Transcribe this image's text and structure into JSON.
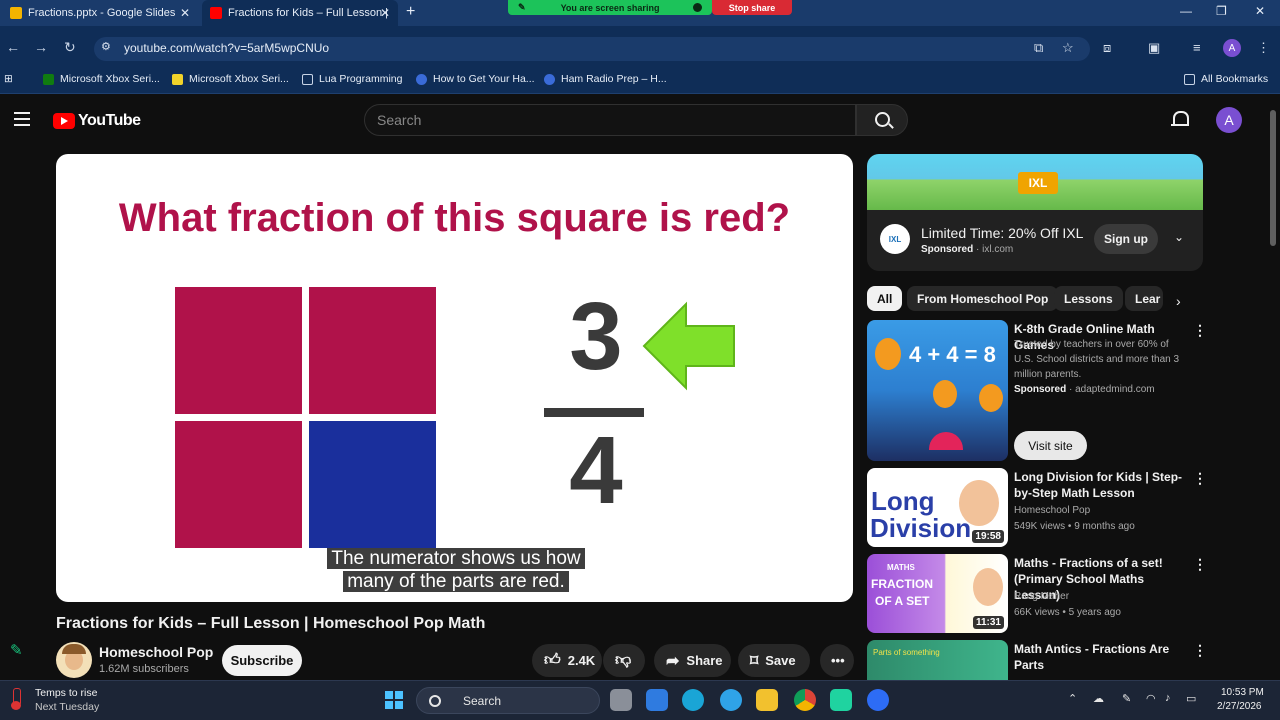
{
  "browser": {
    "tabs": [
      {
        "label": "Fractions.pptx - Google Slides"
      },
      {
        "label": "Fractions for Kids – Full Lesson |"
      }
    ],
    "screen_sharing": "You are screen sharing",
    "stop_share": "Stop share",
    "url": "youtube.com/watch?v=5arM5wpCNUo",
    "profile_initial": "A",
    "bookmarks": [
      {
        "label": "Microsoft Xbox Seri..."
      },
      {
        "label": "Microsoft Xbox Seri..."
      },
      {
        "label": "Lua Programming"
      },
      {
        "label": "How to Get Your Ha..."
      },
      {
        "label": "Ham Radio Prep – H..."
      }
    ],
    "all_bookmarks": "All Bookmarks"
  },
  "youtube": {
    "logo_text": "YouTube",
    "search_placeholder": "Search",
    "avatar_initial": "A"
  },
  "video": {
    "slide_question": "What fraction of this square is red?",
    "fraction_numerator": "3",
    "fraction_denominator": "4",
    "caption_line1": "The numerator shows us how",
    "caption_line2": "many of the parts are red.",
    "title": "Fractions for Kids – Full Lesson | Homeschool Pop Math",
    "channel": "Homeschool Pop",
    "subscribers": "1.62M subscribers",
    "subscribe_label": "Subscribe",
    "likes": "2.4K",
    "share_label": "Share",
    "save_label": "Save",
    "colors": {
      "red": "#b0124a",
      "blue": "#1a2f9c",
      "arrow": "#7fe02a"
    }
  },
  "sidebar": {
    "ad": {
      "badge": "IXL",
      "logo": "IXL",
      "title": "Limited Time: 20% Off IXL",
      "sponsored": "Sponsored",
      "domain": "ixl.com",
      "button": "Sign up"
    },
    "chips": [
      "All",
      "From Homeschool Pop",
      "Lessons",
      "Lear"
    ],
    "items": [
      {
        "title": "K-8th Grade Online Math Games",
        "desc": "Trusted by teachers in over 60% of U.S. School districts and more than 3 million parents.",
        "sponsored": "Sponsored",
        "domain": "adaptedmind.com",
        "button": "Visit site",
        "thumb_text": "4 + 4 = 8"
      },
      {
        "title": "Long Division for Kids | Step-by-Step Math Lesson",
        "channel": "Homeschool Pop",
        "meta": "549K views • 9 months ago",
        "duration": "19:58",
        "thumb_text1": "Long",
        "thumb_text2": "Division"
      },
      {
        "title": "Maths - Fractions of a set! (Primary School Maths Lesson)",
        "channel": "Rang Maher",
        "meta": "66K views • 5 years ago",
        "duration": "11:31",
        "thumb_tag": "MATHS",
        "thumb_text1": "FRACTION",
        "thumb_text2": "OF A SET"
      },
      {
        "title": "Math Antics - Fractions Are Parts",
        "thumb_text": "Parts of something"
      }
    ]
  },
  "taskbar": {
    "weather_line1": "Temps to rise",
    "weather_line2": "Next Tuesday",
    "search_label": "Search",
    "time": "10:53 PM",
    "date": "2/27/2026"
  }
}
